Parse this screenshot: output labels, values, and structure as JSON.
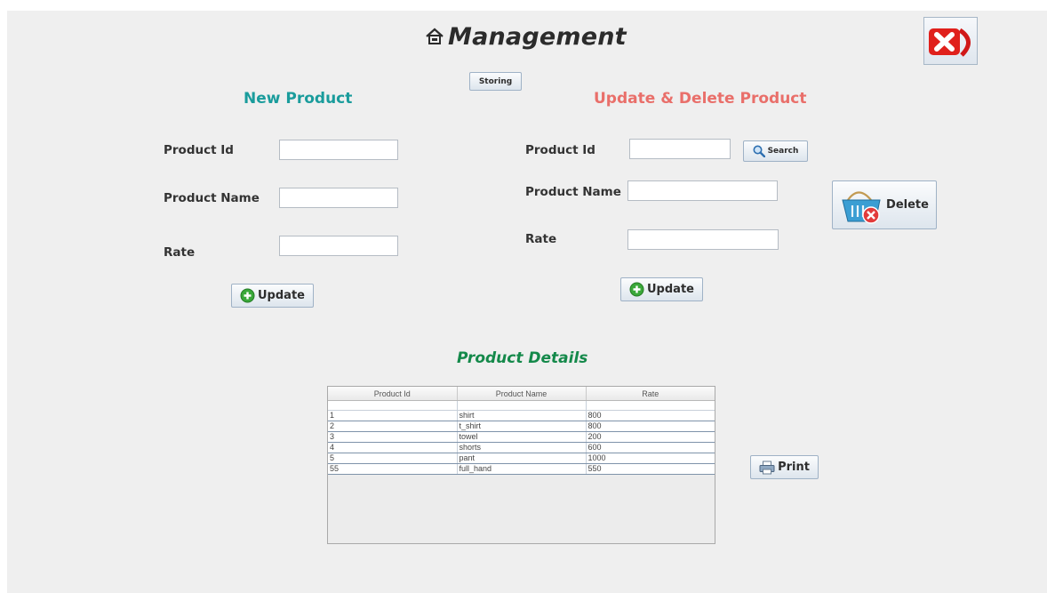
{
  "header": {
    "title": "Management",
    "home_icon": "home-icon",
    "close_icon": "close-icon"
  },
  "toolbar": {
    "storing_label": "Storing"
  },
  "new_product": {
    "heading": "New Product",
    "heading_color": "#1a9c9c",
    "id_label": "Product Id",
    "name_label": "Product Name",
    "rate_label": "Rate",
    "id_value": "",
    "name_value": "",
    "rate_value": "",
    "update_label": "Update"
  },
  "update_product": {
    "heading": "Update & Delete Product",
    "heading_color": "#e96f6a",
    "id_label": "Product Id",
    "name_label": "Product Name",
    "rate_label": "Rate",
    "id_value": "",
    "name_value": "",
    "rate_value": "",
    "search_label": "Search",
    "delete_label": "Delete",
    "update_label": "Update"
  },
  "details": {
    "heading": "Product Details",
    "heading_color": "#14894a",
    "columns": [
      "Product Id",
      "Product Name",
      "Rate"
    ],
    "rows": [
      [
        "1",
        "shirt",
        "800"
      ],
      [
        "2",
        "t_shirt",
        "800"
      ],
      [
        "3",
        "towel",
        "200"
      ],
      [
        "4",
        "shorts",
        "600"
      ],
      [
        "5",
        "pant",
        "1000"
      ],
      [
        "55",
        "full_hand",
        "550"
      ]
    ],
    "print_label": "Print"
  }
}
